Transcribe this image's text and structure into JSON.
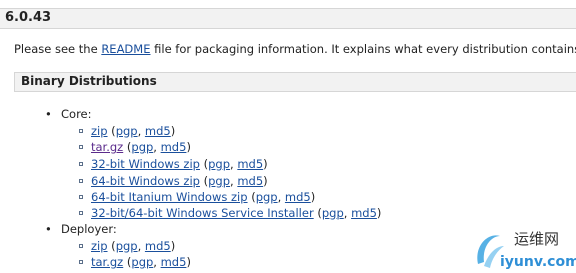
{
  "version": {
    "title": "6.0.43"
  },
  "intro": {
    "before": "Please see the ",
    "link": "README",
    "after": " file for packaging information. It explains what every distribution contains."
  },
  "section": {
    "title": "Binary Distributions"
  },
  "groups": [
    {
      "label": "Core:",
      "items": [
        {
          "label": "zip",
          "pgp": "pgp",
          "md5": "md5"
        },
        {
          "label": "tar.gz",
          "pgp": "pgp",
          "md5": "md5"
        },
        {
          "label": "32-bit Windows zip",
          "pgp": "pgp",
          "md5": "md5"
        },
        {
          "label": "64-bit Windows zip",
          "pgp": "pgp",
          "md5": "md5"
        },
        {
          "label": "64-bit Itanium Windows zip",
          "pgp": "pgp",
          "md5": "md5"
        },
        {
          "label": "32-bit/64-bit Windows Service Installer",
          "pgp": "pgp",
          "md5": "md5"
        }
      ]
    },
    {
      "label": "Deployer:",
      "items": [
        {
          "label": "zip",
          "pgp": "pgp",
          "md5": "md5"
        },
        {
          "label": "tar.gz",
          "pgp": "pgp",
          "md5": "md5"
        }
      ]
    }
  ],
  "watermark": {
    "cn": "运维网",
    "latin": "iyunv.com"
  },
  "colors": {
    "link": "#1a4f9c",
    "visited": "#5b2b8c",
    "header_bg": "#f2f2f2"
  }
}
